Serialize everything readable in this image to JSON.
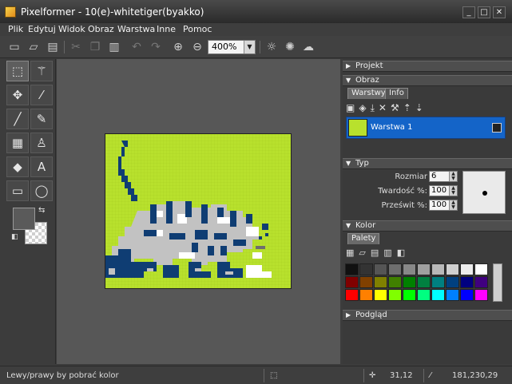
{
  "window": {
    "title": "Pixelformer - 10(e)-whitetiger(byakko)",
    "minimize": "_",
    "maximize": "□",
    "close": "✕"
  },
  "menu": [
    "Plik",
    "Edytuj",
    "Widok",
    "Obraz",
    "Warstwa",
    "Inne",
    "Pomoc"
  ],
  "toolbar": {
    "buttons": [
      "new-icon",
      "open-icon",
      "save-icon",
      "cut-icon",
      "copy-icon",
      "paste-icon",
      "undo-icon",
      "redo-icon",
      "zoom-in-icon",
      "zoom-out-icon"
    ],
    "zoom_value": "400%",
    "light_buttons": [
      "lighten-icon",
      "sun-icon",
      "cloud-icon"
    ]
  },
  "tools": [
    "rect-select-icon",
    "magic-wand-icon",
    "move-icon",
    "eyedropper-icon",
    "pencil-icon",
    "brush-icon",
    "gradient-icon",
    "stamp-icon",
    "eraser-icon",
    "text-icon",
    "rectangle-icon",
    "ellipse-icon"
  ],
  "panels": {
    "projekt": "Projekt",
    "obraz": "Obraz",
    "tabs": [
      "Warstwy",
      "Info"
    ],
    "layer_name": "Warstwa 1",
    "typ": "Typ",
    "rozmiar_label": "Rozmiar",
    "rozmiar_value": "6",
    "twardosc_label": "Twardość  %:",
    "twardosc_value": "100",
    "przeswit_label": "Prześwit %:",
    "przeswit_value": "100",
    "kolor": "Kolor",
    "palety_tab": "Palety",
    "podglad": "Podgląd"
  },
  "palette_colors": [
    "#111111",
    "#333333",
    "#555555",
    "#6e6e6e",
    "#888888",
    "#a0a0a0",
    "#b8b8b8",
    "#d0d0d0",
    "#ececec",
    "#ffffff",
    "#800000",
    "#804000",
    "#808000",
    "#408000",
    "#008000",
    "#008040",
    "#008080",
    "#004080",
    "#000080",
    "#400080",
    "#ff0000",
    "#ff8000",
    "#ffff00",
    "#80ff00",
    "#00ff00",
    "#00ff80",
    "#00ffff",
    "#0080ff",
    "#0000ff",
    "#ff00ff"
  ],
  "status": {
    "hint": "Lewy/prawy by pobrać kolor",
    "coords": "31,12",
    "color": "181,230,29"
  },
  "colors": {
    "canvas_bg": "#b8e12d",
    "tiger_dark": "#0f3d73",
    "tiger_light": "#c2c2c2",
    "tiger_white": "#ffffff",
    "layer_selected": "#1464c8"
  }
}
